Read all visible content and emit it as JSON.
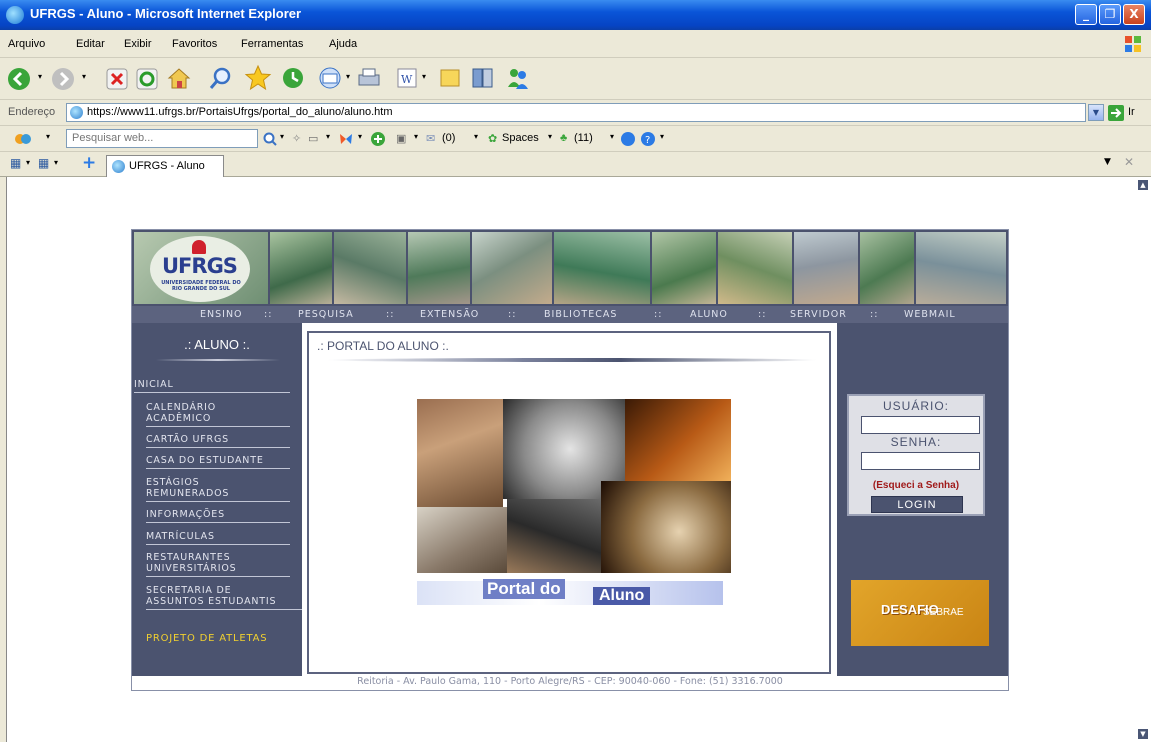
{
  "window": {
    "title": "UFRGS - Aluno - Microsoft Internet Explorer",
    "minimize": "_",
    "restore": "❐",
    "close": "X"
  },
  "menu": [
    "Arquivo",
    "Editar",
    "Exibir",
    "Favoritos",
    "Ferramentas",
    "Ajuda"
  ],
  "address": {
    "label": "Endereço",
    "url": "https://www11.ufrgs.br/PortaisUfrgs/portal_do_aluno/aluno.htm",
    "go_label": "Ir"
  },
  "searchbar": {
    "placeholder": "Pesquisar web...",
    "mail_count": "(0)",
    "spaces": "Spaces",
    "contacts_count": "(11)"
  },
  "tab": {
    "label": "UFRGS - Aluno"
  },
  "page": {
    "logo_text": "UFRGS",
    "logo_subtitle": "UNIVERSIDADE FEDERAL DO RIO GRANDE DO SUL",
    "nav": [
      "ENSINO",
      "::",
      "PESQUISA",
      "::",
      "EXTENSÃO",
      "::",
      "BIBLIOTECAS",
      "::",
      "ALUNO",
      "::",
      "SERVIDOR",
      "::",
      "WEBMAIL"
    ],
    "left_title": ".: ALUNO :.",
    "left_menu": [
      {
        "l1": "INICIAL",
        "l2": ""
      },
      {
        "l1": "CALENDÁRIO",
        "l2": "ACADÊMICO"
      },
      {
        "l1": "CARTÃO UFRGS",
        "l2": ""
      },
      {
        "l1": "CASA DO ESTUDANTE",
        "l2": ""
      },
      {
        "l1": "ESTÁGIOS",
        "l2": "REMUNERADOS"
      },
      {
        "l1": "INFORMAÇÕES",
        "l2": ""
      },
      {
        "l1": "MATRÍCULAS",
        "l2": ""
      },
      {
        "l1": "RESTAURANTES",
        "l2": "UNIVERSITÁRIOS"
      },
      {
        "l1": "SECRETARIA DE",
        "l2": "ASSUNTOS ESTUDANTIS"
      }
    ],
    "left_special": "PROJETO DE ATLETAS",
    "center_title": ".: PORTAL DO ALUNO :.",
    "portal_word1": "Portal do",
    "portal_word2": "Aluno",
    "login": {
      "user_label": "USUÁRIO:",
      "pass_label": "SENHA:",
      "forgot": "(Esqueci a Senha)",
      "button": "LOGIN"
    },
    "promo_text": "DESAFIO",
    "promo_sub": "SEBRAE",
    "footer": "Reitoria - Av. Paulo Gama, 110 - Porto Alegre/RS - CEP: 90040-060 - Fone: (51) 3316.7000"
  }
}
